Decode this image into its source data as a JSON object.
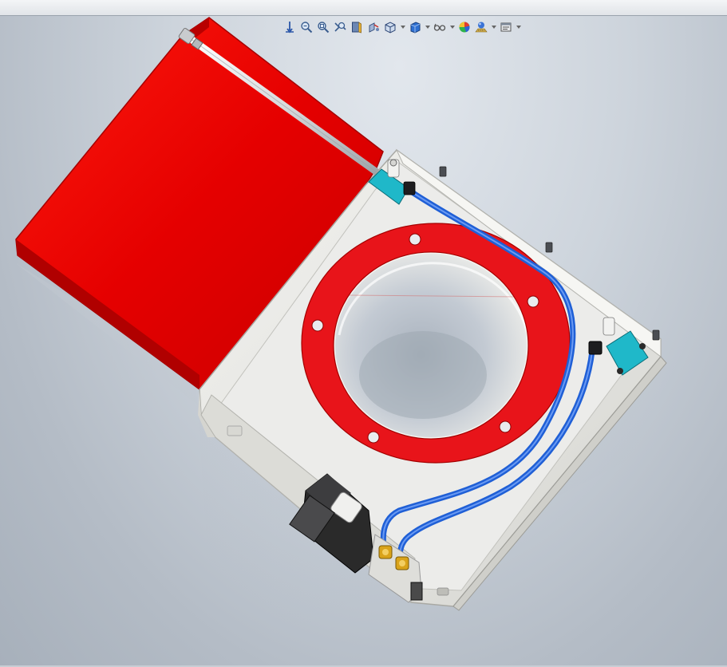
{
  "app": {
    "name": "3D CAD viewport"
  },
  "toolbar": {
    "buttons": [
      {
        "name": "orient-icon",
        "has_dropdown": false
      },
      {
        "name": "zoom-to-fit-icon",
        "has_dropdown": false
      },
      {
        "name": "zoom-to-area-icon",
        "has_dropdown": false
      },
      {
        "name": "previous-view-icon",
        "has_dropdown": false
      },
      {
        "name": "section-view-icon",
        "has_dropdown": false
      },
      {
        "name": "dynamic-annotation-icon",
        "has_dropdown": false
      },
      {
        "name": "view-orientation-icon",
        "has_dropdown": true
      },
      {
        "name": "display-style-icon",
        "has_dropdown": true
      },
      {
        "name": "hide-show-items-icon",
        "has_dropdown": true
      },
      {
        "name": "edit-appearance-icon",
        "has_dropdown": false
      },
      {
        "name": "apply-scene-icon",
        "has_dropdown": true
      },
      {
        "name": "view-settings-icon",
        "has_dropdown": true
      }
    ]
  },
  "model": {
    "description_colors": {
      "gate_door": "#e60000",
      "flange": "#e8141a",
      "housing": "#e9e9e4",
      "tubing": "#1f5fd6",
      "fittings": "#1fb8c9",
      "solenoid": "#2a2a2a",
      "brass": "#d9a31a"
    }
  }
}
